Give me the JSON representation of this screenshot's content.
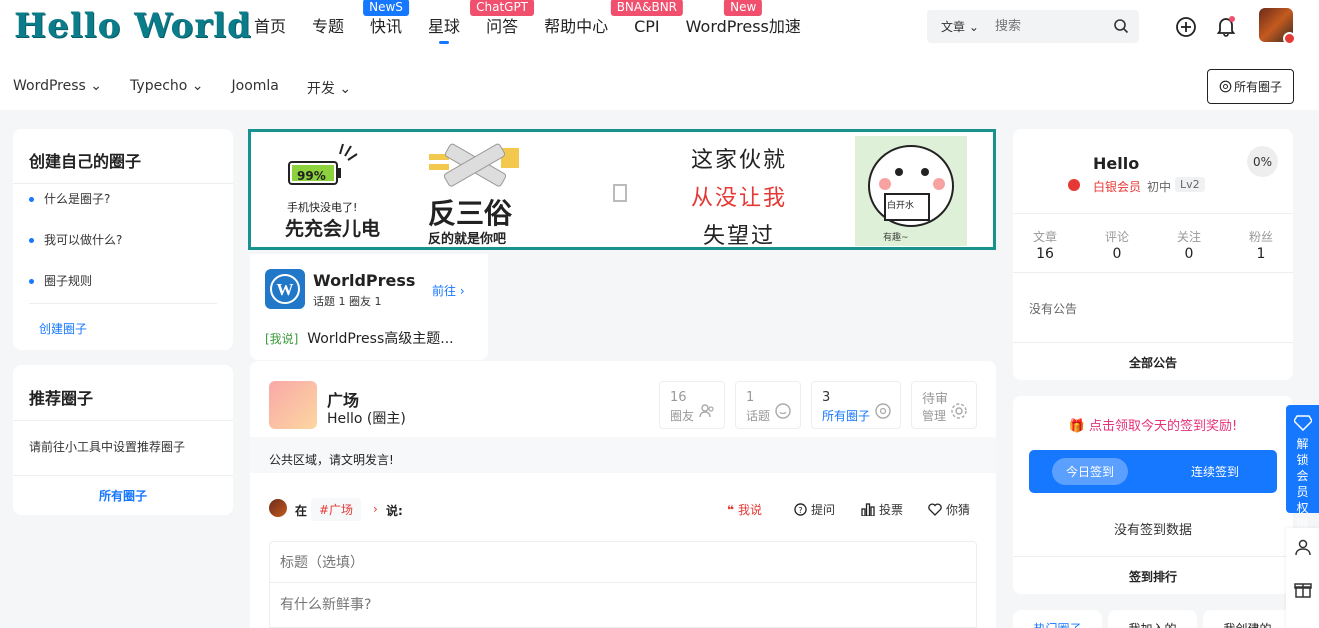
{
  "header": {
    "logo": "Hello World",
    "nav": [
      {
        "label": "首页",
        "badge": "",
        "badge_color": ""
      },
      {
        "label": "专题",
        "badge": "",
        "badge_color": ""
      },
      {
        "label": "快讯",
        "badge": "NewS",
        "badge_color": "#1677ff"
      },
      {
        "label": "星球",
        "badge": "",
        "badge_color": "",
        "active": true
      },
      {
        "label": "问答",
        "badge": "ChatGPT",
        "badge_color": "#f0506e"
      },
      {
        "label": "帮助中心",
        "badge": "",
        "badge_color": ""
      },
      {
        "label": "CPI",
        "badge": "BNA&BNR",
        "badge_color": "#f0506e"
      },
      {
        "label": "WordPress加速",
        "badge": "New",
        "badge_color": "#f0506e"
      }
    ],
    "search": {
      "type": "文章",
      "placeholder": "搜索"
    }
  },
  "subnav": {
    "items": [
      "WordPress",
      "Typecho",
      "Joomla",
      "开发"
    ],
    "all_circles": "所有圈子"
  },
  "left": {
    "create_title": "创建自己的圈子",
    "create_items": [
      "什么是圈子?",
      "我可以做什么?",
      "圈子规则"
    ],
    "create_link": "创建圈子",
    "recommend_title": "推荐圈子",
    "recommend_text": "请前往小工具中设置推荐圈子",
    "recommend_link": "所有圈子"
  },
  "banner": {
    "battery": "99%",
    "phone_text1": "手机快没电了!",
    "phone_text2": "先充会儿电",
    "anti_title": "反三俗",
    "anti_sub": "反的就是你吧",
    "slogan": [
      "这家伙就",
      "从没让我",
      "失望过"
    ],
    "meme_caption": "白开水",
    "meme_text": "有趣~"
  },
  "circle_card": {
    "name": "WorldPress",
    "meta": "话题 1   圈友 1",
    "go": "前往",
    "tag": "[我说]",
    "snippet": "WorldPress高级主题..."
  },
  "plaza": {
    "name": "广场",
    "owner": "Hello (圈主)",
    "stats": [
      {
        "num": "16",
        "label": "圈友"
      },
      {
        "num": "1",
        "label": "话题"
      },
      {
        "num": "3",
        "label": "所有圈子"
      },
      {
        "num": "待审",
        "label": "管理"
      }
    ],
    "notice": "公共区域，请文明发言!"
  },
  "composer": {
    "in": "在",
    "tag": "#广场",
    "say": "说:",
    "actions": [
      "我说",
      "提问",
      "投票",
      "你猜"
    ],
    "title_placeholder": "标题（选填）",
    "body_placeholder": "有什么新鲜事?"
  },
  "profile": {
    "name": "Hello",
    "level_name": "白银会员",
    "rank": "初中",
    "lv": "Lv2",
    "percent": "0%",
    "stats": [
      {
        "label": "文章",
        "value": "16"
      },
      {
        "label": "评论",
        "value": "0"
      },
      {
        "label": "关注",
        "value": "0"
      },
      {
        "label": "粉丝",
        "value": "1"
      }
    ],
    "notice": "没有公告",
    "all_notice": "全部公告"
  },
  "checkin": {
    "reward": "点击领取今天的签到奖励!",
    "today": "今日签到",
    "continuous": "连续签到",
    "empty": "没有签到数据",
    "rank": "签到排行"
  },
  "bottom_tabs": [
    "热门圈子",
    "我加入的",
    "我创建的"
  ],
  "float": {
    "unlock": "解锁会员权限"
  }
}
